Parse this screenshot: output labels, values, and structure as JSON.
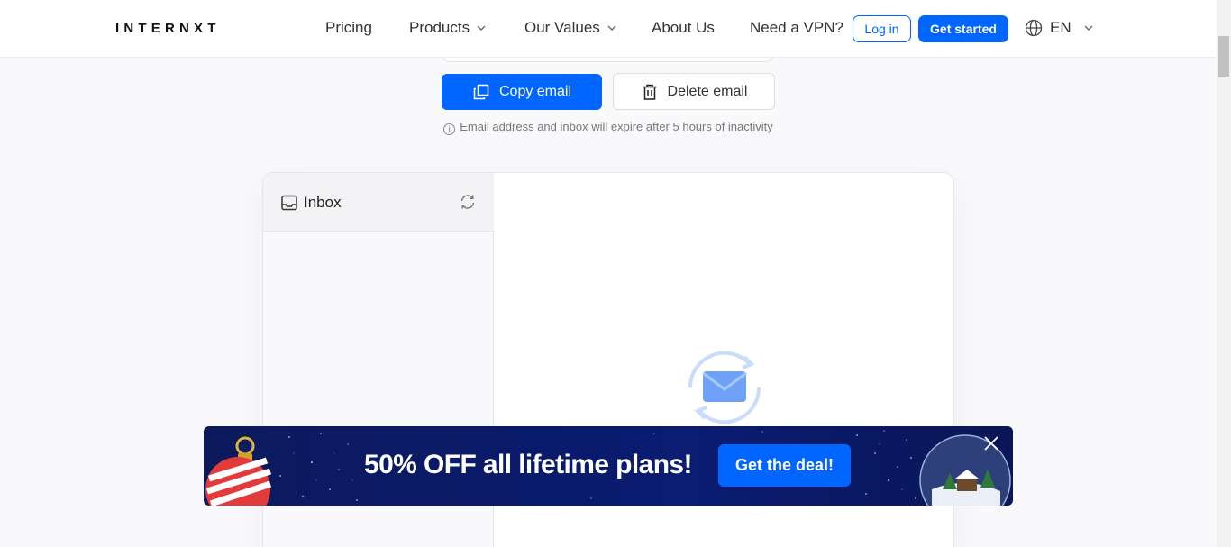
{
  "header": {
    "logo": "INTERNXT",
    "nav": {
      "pricing": "Pricing",
      "products": "Products",
      "our_values": "Our Values",
      "about_us": "About Us",
      "need_vpn": "Need a VPN?"
    },
    "login": "Log in",
    "get_started": "Get started",
    "language": "EN"
  },
  "actions": {
    "copy_email": "Copy email",
    "delete_email": "Delete email",
    "expire_note": "Email address and inbox will expire after 5 hours of inactivity"
  },
  "inbox": {
    "title": "Inbox"
  },
  "banner": {
    "headline": "50% OFF all lifetime plans!",
    "cta": "Get the deal!"
  },
  "colors": {
    "accent": "#0066ff",
    "banner_bg": "#0b1c6a"
  },
  "icons": [
    "globe-icon",
    "chevron-down-icon",
    "copy-icon",
    "trash-icon",
    "info-icon",
    "inbox-tray-icon",
    "refresh-icon",
    "mail-sync-icon",
    "close-icon",
    "ornament-icon",
    "snow-globe-icon"
  ]
}
